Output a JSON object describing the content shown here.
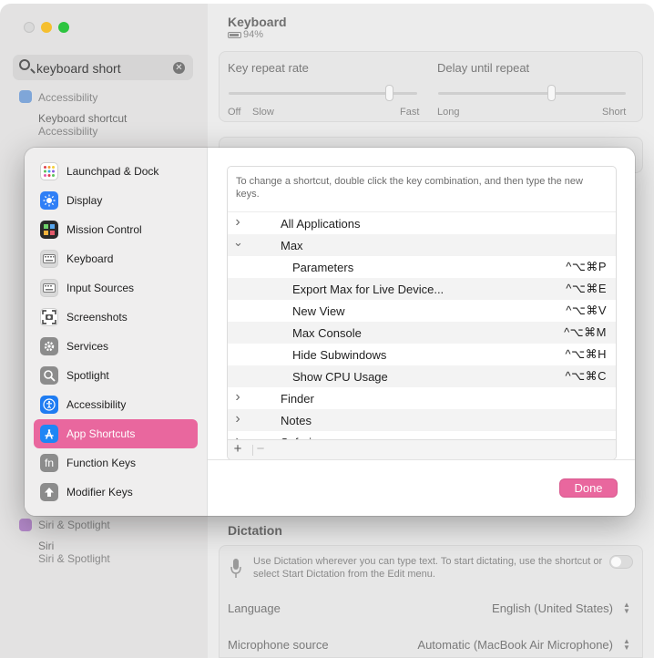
{
  "background": {
    "search": {
      "value": "keyboard short"
    },
    "sidebar_results": [
      {
        "label": "Accessibility"
      },
      {
        "title": "Keyboard shortcut",
        "subtitle": "Accessibility"
      },
      {
        "label": "Siri & Spotlight"
      },
      {
        "title": "Siri",
        "subtitle": "Siri & Spotlight"
      }
    ],
    "main": {
      "title": "Keyboard",
      "battery": "94%",
      "key_repeat": {
        "label": "Key repeat rate",
        "left_labels": [
          "Off",
          "Slow"
        ],
        "right_label": "Fast",
        "level": 0.85
      },
      "delay_repeat": {
        "label": "Delay until repeat",
        "left_label": "Long",
        "right_label": "Short",
        "level": 0.6
      },
      "dictation": {
        "section_title": "Dictation",
        "description": "Use Dictation wherever you can type text. To start dictating, use the shortcut or select Start Dictation from the Edit menu.",
        "language_label": "Language",
        "language_value": "English (United States)",
        "mic_label": "Microphone source",
        "mic_value": "Automatic (MacBook Air Microphone)"
      }
    }
  },
  "sheet": {
    "sidebar": [
      {
        "label": "Launchpad & Dock",
        "icon": "launchpad-icon",
        "color": "#ffffff"
      },
      {
        "label": "Display",
        "icon": "display-icon",
        "color": "#2f7ff6"
      },
      {
        "label": "Mission Control",
        "icon": "mission-control-icon",
        "color": "#2a2a2a"
      },
      {
        "label": "Keyboard",
        "icon": "keyboard-icon",
        "color": "#d9d9d9"
      },
      {
        "label": "Input Sources",
        "icon": "input-sources-icon",
        "color": "#d9d9d9"
      },
      {
        "label": "Screenshots",
        "icon": "screenshots-icon",
        "color": "#ffffff"
      },
      {
        "label": "Services",
        "icon": "services-icon",
        "color": "#8c8c8c"
      },
      {
        "label": "Spotlight",
        "icon": "spotlight-icon",
        "color": "#8c8c8c"
      },
      {
        "label": "Accessibility",
        "icon": "accessibility-icon",
        "color": "#1e7cf2"
      },
      {
        "label": "App Shortcuts",
        "icon": "app-shortcuts-icon",
        "color": "#1e86f5",
        "active": true
      },
      {
        "label": "Function Keys",
        "icon": "function-keys-icon",
        "color": "#8c8c8c"
      },
      {
        "label": "Modifier Keys",
        "icon": "modifier-keys-icon",
        "color": "#8c8c8c"
      }
    ],
    "hint": "To change a shortcut, double click the key combination, and then type the new keys.",
    "rows": [
      {
        "type": "group",
        "name": "All Applications",
        "expanded": false
      },
      {
        "type": "group",
        "name": "Max",
        "expanded": true
      },
      {
        "type": "item",
        "name": "Parameters",
        "keys": "^⌥⌘P"
      },
      {
        "type": "item",
        "name": "Export Max for Live Device...",
        "keys": "^⌥⌘E"
      },
      {
        "type": "item",
        "name": "New View",
        "keys": "^⌥⌘V"
      },
      {
        "type": "item",
        "name": "Max Console",
        "keys": "^⌥⌘M"
      },
      {
        "type": "item",
        "name": "Hide Subwindows",
        "keys": "^⌥⌘H"
      },
      {
        "type": "item",
        "name": "Show CPU Usage",
        "keys": "^⌥⌘C"
      },
      {
        "type": "group",
        "name": "Finder",
        "expanded": false
      },
      {
        "type": "group",
        "name": "Notes",
        "expanded": false
      },
      {
        "type": "group",
        "name": "Safari",
        "expanded": false
      }
    ],
    "add_label": "+",
    "remove_label": "−",
    "done_label": "Done"
  },
  "colors": {
    "accent": "#e9679e"
  }
}
